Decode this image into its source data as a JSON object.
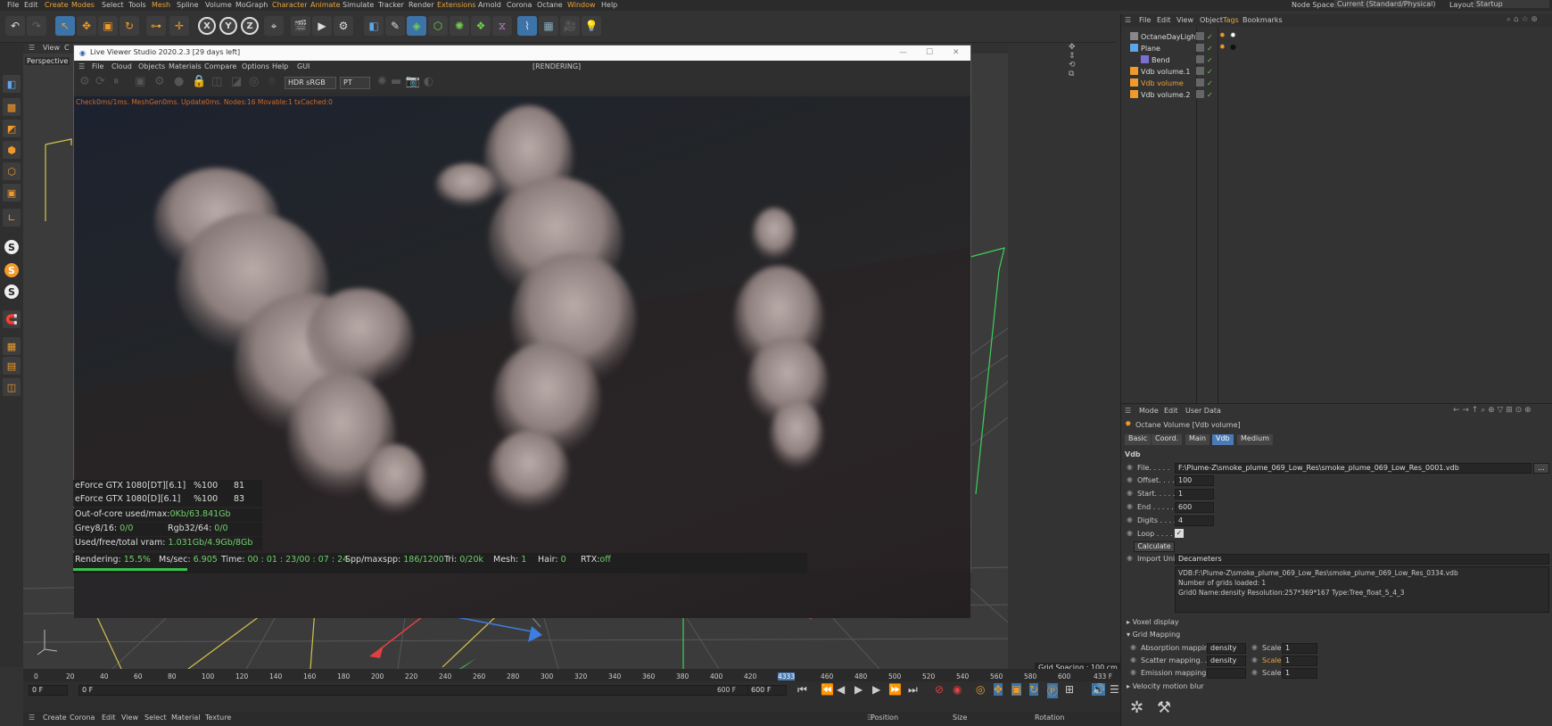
{
  "menubar": {
    "items": [
      "File",
      "Edit",
      "Create",
      "Modes",
      "Select",
      "Tools",
      "Mesh",
      "Spline",
      "Volume",
      "MoGraph",
      "Character",
      "Animate",
      "Simulate",
      "Tracker",
      "Render",
      "Extensions",
      "Arnold",
      "Corona",
      "Octane",
      "Window",
      "Help"
    ],
    "node_space_label": "Node Space:",
    "node_space_value": "Current (Standard/Physical)",
    "layout_label": "Layout:",
    "layout_value": "Startup"
  },
  "toolbar": {
    "x": "X",
    "y": "Y",
    "z": "Z"
  },
  "viewport": {
    "menu": [
      "View",
      "C"
    ],
    "label": "Perspective",
    "grid_spacing": "Grid Spacing : 100 cm"
  },
  "live_viewer": {
    "title": "Live Viewer Studio 2020.2.3 [29 days left]",
    "menu": [
      "File",
      "Cloud",
      "Objects",
      "Materials",
      "Compare",
      "Options",
      "Help",
      "GUI"
    ],
    "status": "[RENDERING]",
    "color_space": "HDR sRGB",
    "kernel": "PT",
    "debug_line": "Check0ms/1ms. MeshGen0ms. Update0ms. Nodes:16 Movable:1 txCached:0",
    "gpu1_name": "eForce GTX 1080[DT][6.1]",
    "gpu1_pct": "%100",
    "gpu1_temp": "81",
    "gpu2_name": "eForce GTX 1080[D][6.1]",
    "gpu2_pct": "%100",
    "gpu2_temp": "83",
    "ooc_label": "Out-of-core used/max:",
    "ooc_value": "0Kb/63.841Gb",
    "grey_label": "Grey8/16:",
    "grey_value": "0/0",
    "rgb_label": "Rgb32/64:",
    "rgb_value": "0/0",
    "vram_label": "Used/free/total vram:",
    "vram_value": "1.031Gb/4.9Gb/8Gb",
    "rendering_label": "Rendering:",
    "rendering_value": "15.5%",
    "mssec_label": "Ms/sec:",
    "mssec_value": "6.905",
    "time_label": "Time:",
    "time_value": "00 : 01 : 23/00 : 07 : 24",
    "spp_label": "Spp/maxspp:",
    "spp_value": "186/1200",
    "tri_label": "Tri:",
    "tri_value": "0/20k",
    "mesh_label": "Mesh:",
    "mesh_value": "1",
    "hair_label": "Hair:",
    "hair_value": "0",
    "rtx_label": "RTX:",
    "rtx_value": "off",
    "progress": 0.155
  },
  "object_manager": {
    "menu": [
      "File",
      "Edit",
      "View",
      "Object",
      "Tags",
      "Bookmarks"
    ],
    "objects": [
      "OctaneDayLight",
      "Plane",
      "Bend",
      "Vdb volume.1",
      "Vdb volume",
      "Vdb volume.2"
    ]
  },
  "attributes": {
    "menu": [
      "Mode",
      "Edit",
      "User Data"
    ],
    "object_title": "Octane Volume [Vdb volume]",
    "tabs": [
      "Basic",
      "Coord.",
      "Main",
      "Vdb",
      "Medium"
    ],
    "section": "Vdb",
    "file_label": "File. . . . .",
    "file_value": "F:\\Plume-Z\\smoke_plume_069_Low_Res\\smoke_plume_069_Low_Res_0001.vdb",
    "file_btn": "...",
    "offset_label": "Offset. . . .",
    "offset_value": "100",
    "start_label": "Start. . . . .",
    "start_value": "1",
    "end_label": "End . . . . .",
    "end_value": "600",
    "digits_label": "Digits . . . .",
    "digits_value": "4",
    "loop_label": "Loop . . . .",
    "calculate": "Calculate",
    "import_unit_label": "Import Unit",
    "import_unit_value": "Decameters",
    "info_line1": "VDB:F:\\Plume-Z\\smoke_plume_069_Low_Res\\smoke_plume_069_Low_Res_0334.vdb",
    "info_line2": "Number of grids loaded: 1",
    "info_line3": "Grid0  Name:density  Resolution:257*369*167  Type:Tree_float_5_4_3",
    "voxel_display": "Voxel display",
    "grid_mapping": "Grid Mapping",
    "absorption_label": "Absorption mapping",
    "absorption_value": "density",
    "scatter_label": "Scatter mapping. .",
    "scatter_value": "density",
    "emission_label": "Emission mapping .",
    "emission_value": "",
    "scale_label": "Scale",
    "scale1": "1",
    "scale2": "1",
    "scale3": "1",
    "velocity": "Velocity motion blur"
  },
  "timeline": {
    "ticks": [
      "0",
      "20",
      "40",
      "60",
      "80",
      "100",
      "120",
      "140",
      "160",
      "180",
      "200",
      "220",
      "240",
      "260",
      "280",
      "300",
      "320",
      "340",
      "360",
      "380",
      "400",
      "420",
      "4333",
      "460",
      "480",
      "500",
      "520",
      "540",
      "560",
      "580",
      "600"
    ],
    "current_frame": "433 F",
    "start_field": "0 F",
    "start_field2": "0 F",
    "end_field": "600 F",
    "end_field2": "600 F"
  },
  "bottom_bar": {
    "menu": [
      "Create",
      "Corona",
      "Edit",
      "View",
      "Select",
      "Material",
      "Texture"
    ],
    "coords": [
      "Position",
      "Size",
      "Rotation"
    ]
  },
  "colors": {
    "accent": "#e8a43a",
    "progress": "#36c44a",
    "active_tab": "#4a7bb4",
    "stat_green": "#6fd06a"
  }
}
